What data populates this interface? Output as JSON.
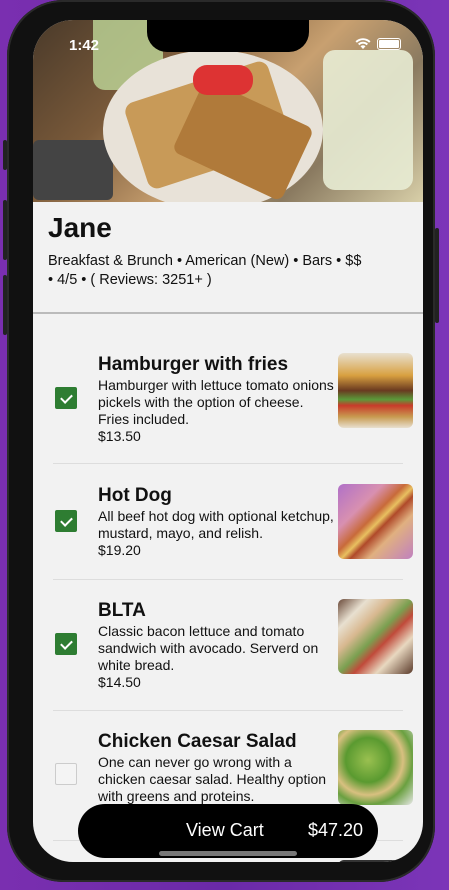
{
  "status_bar": {
    "time": "1:42"
  },
  "restaurant": {
    "name": "Jane",
    "meta_line1": "Breakfast & Brunch • American (New) • Bars  • $$",
    "meta_line2": "• 4/5 • ( Reviews: 3251+ )"
  },
  "menu": {
    "items": [
      {
        "title": "Hamburger with fries",
        "description": "Hamburger with lettuce tomato onions pickels with the option of cheese. Fries included.",
        "price": "$13.50",
        "checked": true,
        "thumb_icon": "hamburger-photo"
      },
      {
        "title": "Hot Dog",
        "description": "All beef hot dog with optional ketchup, mustard, mayo, and relish.",
        "price": "$19.20",
        "checked": true,
        "thumb_icon": "hot-dog-photo"
      },
      {
        "title": "BLTA",
        "description": "Classic bacon lettuce and tomato sandwich with avocado. Serverd on white bread.",
        "price": "$14.50",
        "checked": true,
        "thumb_icon": "sandwich-photo"
      },
      {
        "title": "Chicken Caesar Salad",
        "description": "One can never go wrong with a chicken caesar salad. Healthy option with greens and proteins.",
        "price": "",
        "checked": false,
        "thumb_icon": "salad-photo"
      }
    ]
  },
  "cart": {
    "label": "View Cart",
    "total": "$47.20"
  },
  "colors": {
    "checkbox_checked": "#2e7d32",
    "cart_button": "#000000"
  }
}
